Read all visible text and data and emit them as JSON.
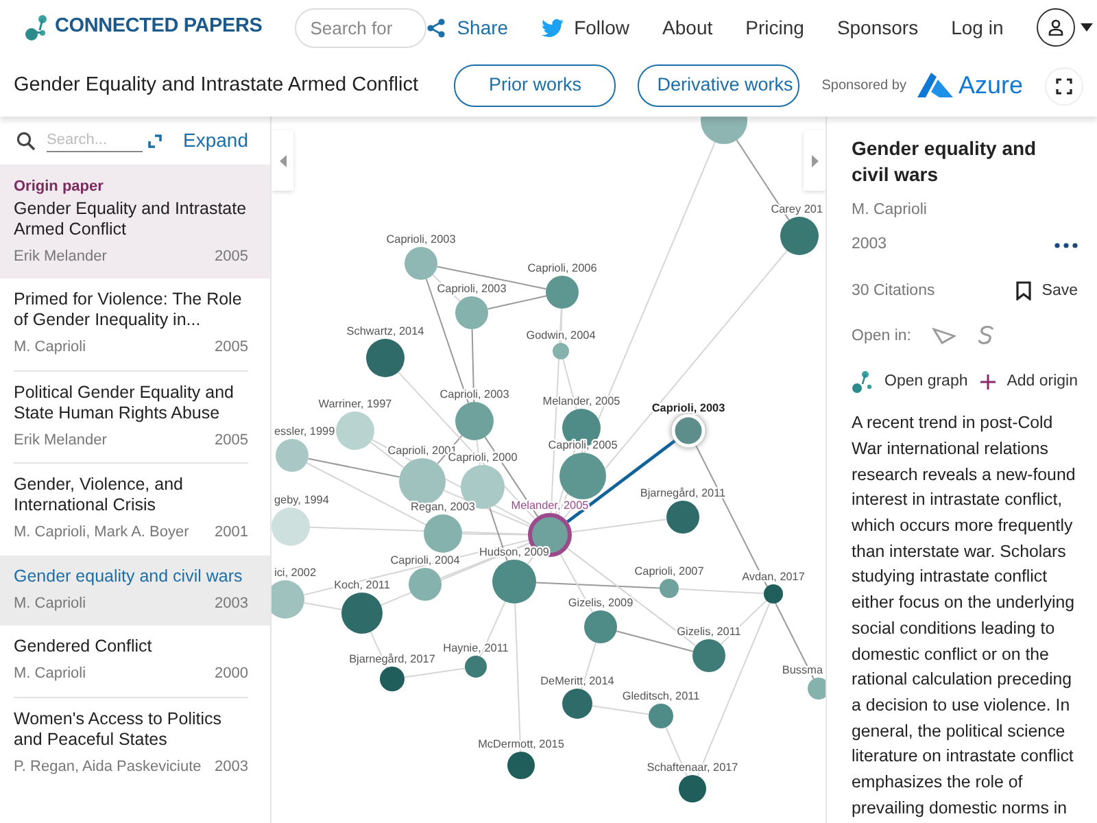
{
  "header": {
    "logo_text": "CONNECTED PAPERS",
    "search": {
      "placeholder": "Search for"
    },
    "nav": [
      {
        "label": "Share",
        "kind": "share"
      },
      {
        "label": "Follow",
        "kind": "twitter"
      },
      {
        "label": "About",
        "kind": "link"
      },
      {
        "label": "Pricing",
        "kind": "link"
      },
      {
        "label": "Sponsors",
        "kind": "link"
      },
      {
        "label": "Log in",
        "kind": "link"
      }
    ]
  },
  "toolbar": {
    "title": "Gender Equality and Intrastate Armed Conflict",
    "buttons": [
      "Prior works",
      "Derivative works"
    ],
    "sponsor_label": "Sponsored by",
    "sponsor_name": "Azure"
  },
  "sidebar": {
    "search": {
      "placeholder": "Search..."
    },
    "expand": "Expand",
    "papers": [
      {
        "tag": "Origin paper",
        "title": "Gender Equality and Intrastate Armed Conflict",
        "authors": "Erik Melander",
        "year": "2005",
        "origin": true,
        "selected": false
      },
      {
        "title": "Primed for Violence: The Role of Gender Inequality in...",
        "authors": "M. Caprioli",
        "year": "2005",
        "origin": false,
        "selected": false
      },
      {
        "title": "Political Gender Equality and State Human Rights Abuse",
        "authors": "Erik Melander",
        "year": "2005",
        "origin": false,
        "selected": false
      },
      {
        "title": "Gender, Violence, and International Crisis",
        "authors": "M. Caprioli, Mark A. Boyer",
        "year": "2001",
        "origin": false,
        "selected": false
      },
      {
        "title": "Gender equality and civil wars",
        "authors": "M. Caprioli",
        "year": "2003",
        "origin": false,
        "selected": true
      },
      {
        "title": "Gendered Conflict",
        "authors": "M. Caprioli",
        "year": "2000",
        "origin": false,
        "selected": false
      },
      {
        "title": "Women's Access to Politics and Peaceful States",
        "authors": "P. Regan, Aida Paskeviciute",
        "year": "2003",
        "origin": false,
        "selected": false
      }
    ]
  },
  "graph": {
    "nodes": [
      {
        "color": "#8fb5b2",
        "origin": false,
        "selected": false
      },
      {
        "label": "Carey 201",
        "color": "#3a7874",
        "origin": false,
        "selected": false
      },
      {
        "label": "Caprioli, 2003",
        "color": "#8fb8b5",
        "origin": false,
        "selected": false
      },
      {
        "label": "Caprioli, 2006",
        "color": "#5e9692",
        "origin": false,
        "selected": false
      },
      {
        "label": "Caprioli, 2003",
        "color": "#86b2ae",
        "origin": false,
        "selected": false
      },
      {
        "label": "Godwin, 2004",
        "color": "#86b2ae",
        "origin": false,
        "selected": false
      },
      {
        "label": "Schwartz, 2014",
        "color": "#2f6b69",
        "origin": false,
        "selected": false
      },
      {
        "label": "Caprioli, 2003",
        "color": "#6fa19d",
        "origin": false,
        "selected": false
      },
      {
        "label": "Melander, 2005",
        "color": "#4f8b87",
        "origin": false,
        "selected": false
      },
      {
        "label": "Caprioli, 2003",
        "color": "#5e8e8b",
        "origin": false,
        "selected": true
      },
      {
        "label": "Warriner, 1997",
        "color": "#b9d3d1",
        "origin": false,
        "selected": false
      },
      {
        "label": "essler, 1999",
        "color": "#a9c8c5",
        "origin": false,
        "selected": false
      },
      {
        "label": "Caprioli, 2001",
        "color": "#9fc2bf",
        "origin": false,
        "selected": false
      },
      {
        "label": "Caprioli, 2000",
        "color": "#a9c9c6",
        "origin": false,
        "selected": false
      },
      {
        "label": "Caprioli, 2005",
        "color": "#5e9692",
        "origin": false,
        "selected": false
      },
      {
        "label": "geby, 1994",
        "color": "#cde0de",
        "origin": false,
        "selected": false
      },
      {
        "label": "Regan, 2003",
        "color": "#86b2ae",
        "origin": false,
        "selected": false
      },
      {
        "label": "Melander, 2005",
        "color": "#6fa19d",
        "origin": true,
        "selected": false
      },
      {
        "label": "Bjarnegård, 2011",
        "color": "#2f6b69",
        "origin": false,
        "selected": false
      },
      {
        "label": "ici, 2002",
        "color": "#9fc2bf",
        "origin": false,
        "selected": false
      },
      {
        "label": "Caprioli, 2004",
        "color": "#86b2ae",
        "origin": false,
        "selected": false
      },
      {
        "label": "Hudson, 2009",
        "color": "#4f8b87",
        "origin": false,
        "selected": false
      },
      {
        "label": "Caprioli, 2007",
        "color": "#6fa19d",
        "origin": false,
        "selected": false
      },
      {
        "label": "Avdan, 2017",
        "color": "#1f5e5b",
        "origin": false,
        "selected": false
      },
      {
        "label": "Koch, 2011",
        "color": "#2f6b69",
        "origin": false,
        "selected": false
      },
      {
        "label": "Gizelis, 2009",
        "color": "#4f8b87",
        "origin": false,
        "selected": false
      },
      {
        "label": "Gizelis, 2011",
        "color": "#3f7b77",
        "origin": false,
        "selected": false
      },
      {
        "label": "Haynie, 2011",
        "color": "#3f7b77",
        "origin": false,
        "selected": false
      },
      {
        "label": "Bjarnegård, 2017",
        "color": "#1f5e5b",
        "origin": false,
        "selected": false
      },
      {
        "label": "DeMeritt, 2014",
        "color": "#2f6b69",
        "origin": false,
        "selected": false
      },
      {
        "label": "Gleditsch, 2011",
        "color": "#4f8b87",
        "origin": false,
        "selected": false
      },
      {
        "label": "Bussma",
        "color": "#86b2ae",
        "origin": false,
        "selected": false
      },
      {
        "label": "McDermott, 2015",
        "color": "#1f5e5b",
        "origin": false,
        "selected": false
      },
      {
        "label": "Schaftenaar, 2017",
        "color": "#1f5e5b",
        "origin": false,
        "selected": false
      }
    ]
  },
  "details": {
    "title": "Gender equality and civil wars",
    "authors": "M. Caprioli",
    "year": "2003",
    "citations": "30 Citations",
    "save": "Save",
    "open_in": "Open in:",
    "actions": [
      {
        "label": "Open graph",
        "kind": "graph"
      },
      {
        "label": "Add origin",
        "kind": "add"
      }
    ],
    "abstract": "A recent trend in post-Cold War international relations research reveals a new-found interest in intrastate conflict, which occurs more frequently than interstate war. Scholars studying intrastate conflict either focus on the underlying social conditions leading to domestic conflict or on the rational calculation preceding a decision to use violence. In general, the political science literature on intrastate conflict emphasizes the role of prevailing domestic norms in"
  }
}
